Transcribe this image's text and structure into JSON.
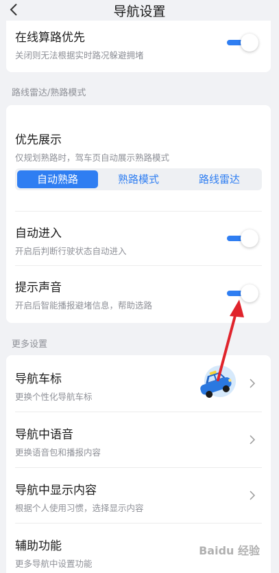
{
  "header": {
    "title": "导航设置"
  },
  "online_route": {
    "title": "在线算路优先",
    "subtitle": "关闭则无法根据实时路况躲避拥堵",
    "enabled": true
  },
  "section_radar": {
    "label": "路线雷达/熟路模式"
  },
  "priority_display": {
    "title": "优先展示",
    "subtitle": "仅规划熟路时，驾车页自动展示熟路模式",
    "options": [
      "自动熟路",
      "熟路模式",
      "路线雷达"
    ],
    "selected": "自动熟路"
  },
  "auto_enter": {
    "title": "自动进入",
    "subtitle": "开启后判断行驶状态自动进入",
    "enabled": true
  },
  "prompt_sound": {
    "title": "提示声音",
    "subtitle": "开启后智能播报避堵信息，帮助选路",
    "enabled": true
  },
  "section_more": {
    "label": "更多设置"
  },
  "more_items": [
    {
      "title": "导航车标",
      "subtitle": "更换个性化导航车标",
      "icon": "blue-car-icon"
    },
    {
      "title": "导航中语音",
      "subtitle": "更换语音包和播报内容"
    },
    {
      "title": "导航中显示内容",
      "subtitle": "根据个人使用习惯，选择显示内容"
    },
    {
      "title": "辅助功能",
      "subtitle": "更多导航中设置功能"
    }
  ],
  "watermark": "Baidu 经验",
  "colors": {
    "accent": "#2f7ef2",
    "annotation": "#e0242c"
  }
}
